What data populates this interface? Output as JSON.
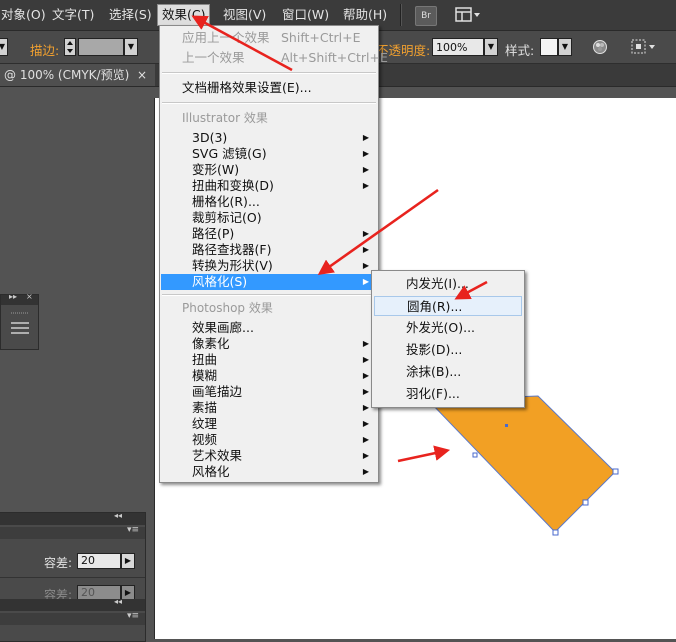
{
  "menubar": {
    "items": [
      "对象(O)",
      "文字(T)",
      "选择(S)",
      "效果(C)",
      "视图(V)",
      "窗口(W)",
      "帮助(H)"
    ],
    "bridge_label": "Br"
  },
  "controlbar": {
    "stroke_label": "描边:",
    "opacity_label": "不透明度:",
    "opacity_value": "100%",
    "style_label": "样式:"
  },
  "tab": {
    "title": "@ 100% (CMYK/预览)",
    "close": "×"
  },
  "panels": {
    "tolerance_label": "容差:",
    "tolerance_value": "20",
    "tolerance_label_2": "容差:",
    "tolerance_value_2": "20"
  },
  "effect_menu": {
    "apply_last": "应用上一个效果",
    "apply_last_shortcut": "Shift+Ctrl+E",
    "last_effect": "上一个效果",
    "last_effect_shortcut": "Alt+Shift+Ctrl+E",
    "raster_settings": "文档栅格效果设置(E)...",
    "illustrator_title": "Illustrator 效果",
    "illustrator_items": [
      "3D(3)",
      "SVG 滤镜(G)",
      "变形(W)",
      "扭曲和变换(D)",
      "栅格化(R)...",
      "裁剪标记(O)",
      "路径(P)",
      "路径查找器(F)",
      "转换为形状(V)",
      "风格化(S)"
    ],
    "photoshop_title": "Photoshop 效果",
    "photoshop_items": [
      "效果画廊...",
      "像素化",
      "扭曲",
      "模糊",
      "画笔描边",
      "素描",
      "纹理",
      "视频",
      "艺术效果",
      "风格化"
    ]
  },
  "stylize_submenu": {
    "items": [
      "内发光(I)...",
      "圆角(R)...",
      "外发光(O)...",
      "投影(D)...",
      "涂抹(B)...",
      "羽化(F)..."
    ]
  },
  "colors": {
    "shape_fill": "#f2a024",
    "selection": "#3399ff",
    "annotation_arrow": "#e8231e",
    "label_orange": "#f0a030"
  }
}
